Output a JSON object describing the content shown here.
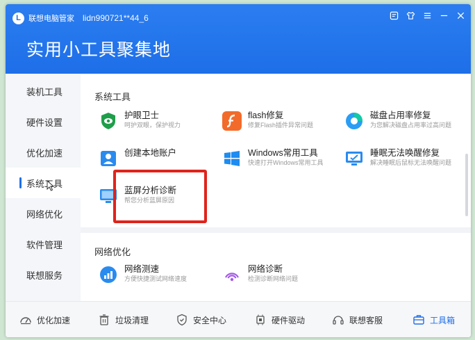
{
  "app": {
    "name": "联想电脑管家",
    "account": "lidn990721**44_6",
    "title": "实用小工具聚集地"
  },
  "sidebar": {
    "items": [
      {
        "label": "装机工具"
      },
      {
        "label": "硬件设置"
      },
      {
        "label": "优化加速"
      },
      {
        "label": "系统工具",
        "active": true
      },
      {
        "label": "网络优化"
      },
      {
        "label": "软件管理"
      },
      {
        "label": "联想服务"
      }
    ]
  },
  "sections": {
    "system_tools": {
      "title": "系统工具",
      "tools": [
        {
          "name": "护眼卫士",
          "desc": "呵护双眼，保护视力",
          "icon": "shield-eye-icon"
        },
        {
          "name": "flash修复",
          "desc": "修复Flash插件异常问题",
          "icon": "flash-icon"
        },
        {
          "name": "磁盘占用率修复",
          "desc": "为您解决磁盘占用率过高问题",
          "icon": "disk-usage-icon"
        },
        {
          "name": "创建本地账户",
          "desc": "",
          "icon": "local-account-icon"
        },
        {
          "name": "Windows常用工具",
          "desc": "快速打开Windows常用工具",
          "icon": "windows-icon"
        },
        {
          "name": "睡眠无法唤醒修复",
          "desc": "解决睡眠后鼠标无法唤醒问题",
          "icon": "sleep-monitor-icon"
        },
        {
          "name": "蓝屏分析诊断",
          "desc": "帮您分析蓝屏原因",
          "icon": "bluescreen-monitor-icon"
        }
      ]
    },
    "network": {
      "title": "网络优化",
      "tools": [
        {
          "name": "网络测速",
          "desc": "方便快捷测试网络速度",
          "icon": "speed-test-icon"
        },
        {
          "name": "网络诊断",
          "desc": "检测诊断网络问题",
          "icon": "network-diagnose-icon"
        }
      ]
    }
  },
  "bottombar": {
    "items": [
      {
        "label": "优化加速",
        "icon": "speedometer-icon"
      },
      {
        "label": "垃圾清理",
        "icon": "trash-icon"
      },
      {
        "label": "安全中心",
        "icon": "shield-icon"
      },
      {
        "label": "硬件驱动",
        "icon": "chip-icon"
      },
      {
        "label": "联想客服",
        "icon": "headset-icon"
      },
      {
        "label": "工具箱",
        "icon": "toolbox-icon",
        "active": true
      }
    ]
  },
  "colors": {
    "brand_blue": "#1e6fe8",
    "highlight_red": "#e0231b",
    "shield_green": "#1f9e4a",
    "flash_orange": "#f26b2a"
  }
}
